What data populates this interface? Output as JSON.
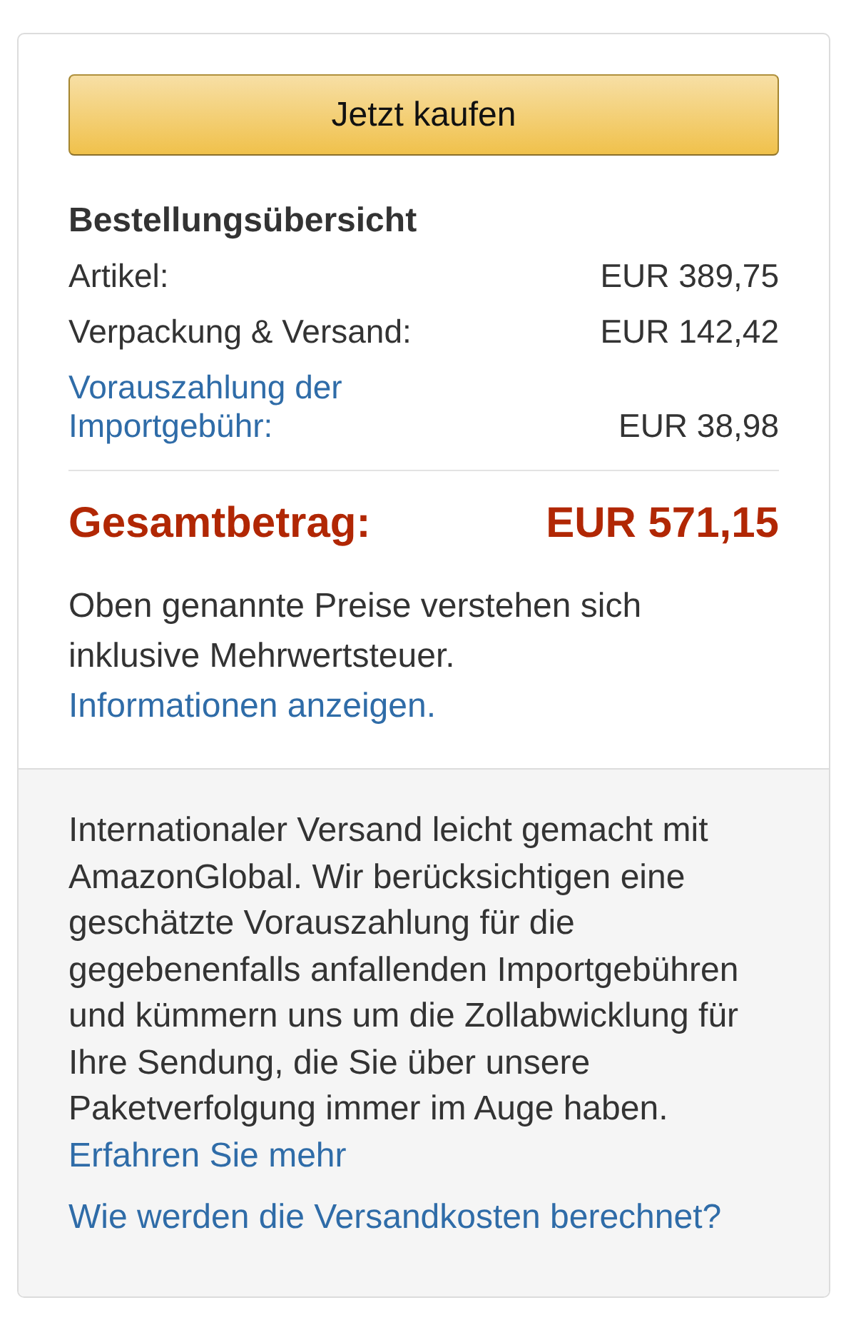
{
  "buy_button": {
    "label": "Jetzt kaufen"
  },
  "order_summary": {
    "title": "Bestellungsübersicht",
    "lines": [
      {
        "kind": "plain",
        "label": "Artikel:",
        "amount": "EUR 389,75"
      },
      {
        "kind": "plain",
        "label": "Verpackung & Versand:",
        "amount": "EUR 142,42"
      },
      {
        "kind": "link",
        "label": "Vorauszahlung der Importgebühr:",
        "amount": "EUR 38,98"
      }
    ],
    "total": {
      "label": "Gesamtbetrag:",
      "amount": "EUR 571,15"
    },
    "tax_note": {
      "text": "Oben genannte Preise verstehen sich inklusive Mehrwertsteuer.",
      "link": "Informationen anzeigen."
    }
  },
  "global_shipping": {
    "text": "Internationaler Versand leicht gemacht mit AmazonGlobal. Wir berücksichtigen eine geschätzte Vorauszahlung für die gegebenenfalls anfallenden Importgebühren und kümmern uns um die Zollabwicklung für Ihre Sendung, die Sie über unsere Paketverfolgung immer im Auge haben.",
    "learn_more_link": "Erfahren Sie mehr",
    "shipping_costs_link": "Wie werden die Versandkosten berechnet?"
  }
}
